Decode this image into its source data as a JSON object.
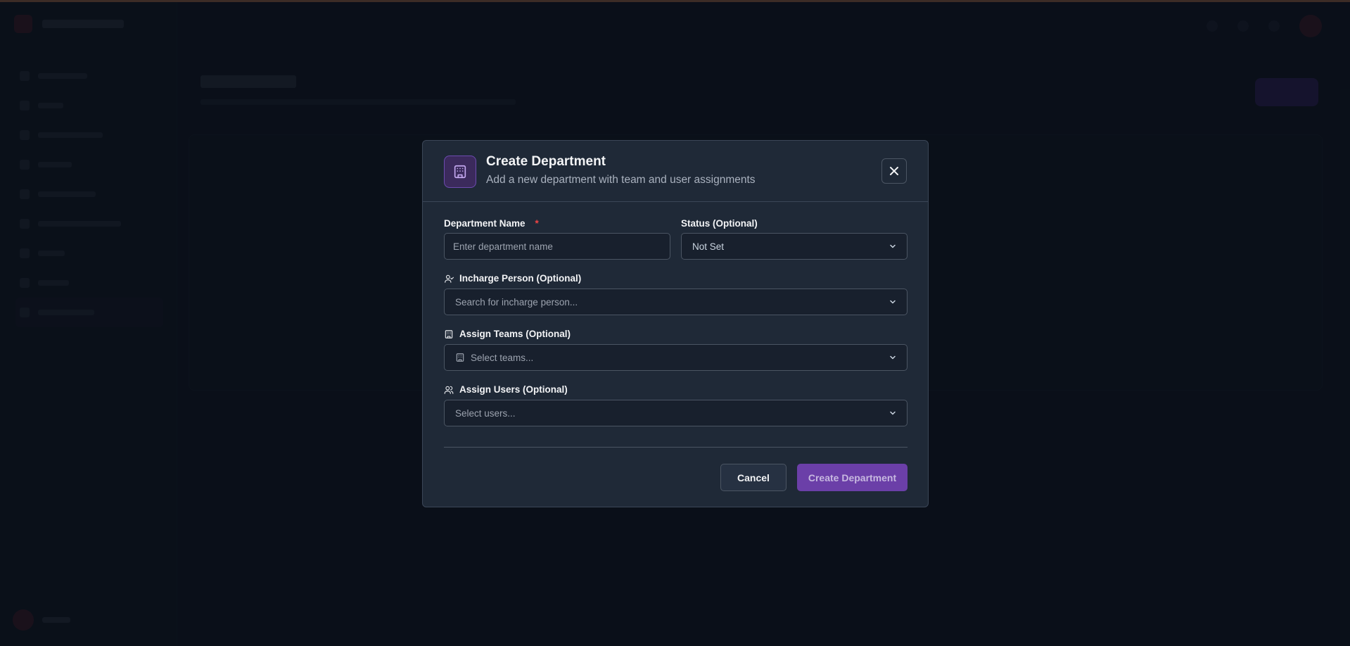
{
  "modal": {
    "title": "Create Department",
    "subtitle": "Add a new department with team and user assignments",
    "fields": {
      "department_name": {
        "label": "Department Name",
        "required_marker": "*",
        "placeholder": "Enter department name",
        "value": ""
      },
      "status": {
        "label": "Status (Optional)",
        "selected": "Not Set"
      },
      "incharge": {
        "label": "Incharge Person (Optional)",
        "placeholder": "Search for incharge person..."
      },
      "teams": {
        "label": "Assign Teams (Optional)",
        "placeholder": "Select teams..."
      },
      "users": {
        "label": "Assign Users (Optional)",
        "placeholder": "Select users..."
      }
    },
    "buttons": {
      "cancel": "Cancel",
      "create": "Create Department"
    }
  },
  "colors": {
    "accent": "#6b3fa8",
    "required": "#ef4444",
    "modal_bg": "#1f2937",
    "page_bg": "#0f1521"
  },
  "icons": [
    "building-icon",
    "close-icon",
    "user-icon",
    "users-icon",
    "chevron-down-icon"
  ]
}
